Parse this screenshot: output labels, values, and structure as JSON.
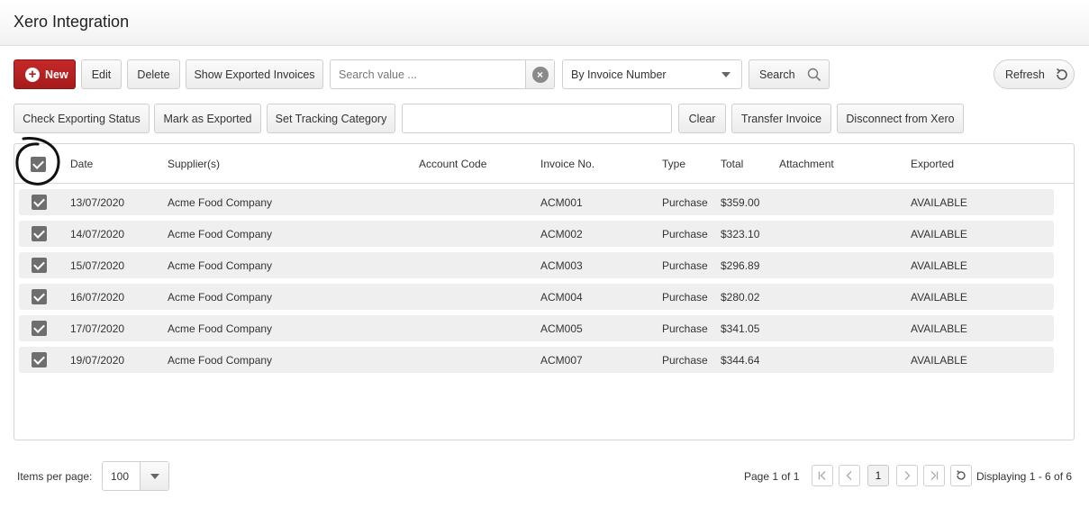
{
  "header": {
    "title": "Xero Integration"
  },
  "toolbar1": {
    "new_label": "New",
    "edit_label": "Edit",
    "delete_label": "Delete",
    "show_exported_label": "Show Exported Invoices",
    "search_placeholder": "Search value ...",
    "search_by_selected": "By Invoice Number",
    "search_label": "Search",
    "refresh_label": "Refresh"
  },
  "toolbar2": {
    "check_status_label": "Check Exporting Status",
    "mark_exported_label": "Mark as Exported",
    "set_tracking_label": "Set Tracking Category",
    "tracking_value": "",
    "clear_label": "Clear",
    "transfer_label": "Transfer Invoice",
    "disconnect_label": "Disconnect from Xero"
  },
  "table": {
    "columns": [
      "Date",
      "Supplier(s)",
      "Account Code",
      "Invoice No.",
      "Type",
      "Total",
      "Attachment",
      "Exported"
    ],
    "rows": [
      {
        "date": "13/07/2020",
        "supplier": "Acme Food Company",
        "account_code": "",
        "invoice_no": "ACM001",
        "type": "Purchase",
        "total": "$359.00",
        "attachment": "",
        "exported": "AVAILABLE"
      },
      {
        "date": "14/07/2020",
        "supplier": "Acme Food Company",
        "account_code": "",
        "invoice_no": "ACM002",
        "type": "Purchase",
        "total": "$323.10",
        "attachment": "",
        "exported": "AVAILABLE"
      },
      {
        "date": "15/07/2020",
        "supplier": "Acme Food Company",
        "account_code": "",
        "invoice_no": "ACM003",
        "type": "Purchase",
        "total": "$296.89",
        "attachment": "",
        "exported": "AVAILABLE"
      },
      {
        "date": "16/07/2020",
        "supplier": "Acme Food Company",
        "account_code": "",
        "invoice_no": "ACM004",
        "type": "Purchase",
        "total": "$280.02",
        "attachment": "",
        "exported": "AVAILABLE"
      },
      {
        "date": "17/07/2020",
        "supplier": "Acme Food Company",
        "account_code": "",
        "invoice_no": "ACM005",
        "type": "Purchase",
        "total": "$341.05",
        "attachment": "",
        "exported": "AVAILABLE"
      },
      {
        "date": "19/07/2020",
        "supplier": "Acme Food Company",
        "account_code": "",
        "invoice_no": "ACM007",
        "type": "Purchase",
        "total": "$344.64",
        "attachment": "",
        "exported": "AVAILABLE"
      }
    ]
  },
  "footer": {
    "items_per_page_label": "Items per page:",
    "items_per_page_value": "100",
    "page_info": "Page 1 of 1",
    "current_page": "1",
    "displaying": "Displaying 1 - 6 of 6"
  },
  "colors": {
    "accent": "#b71c1c",
    "row_bg": "#efefef",
    "checkbox": "#6e6e6e"
  },
  "icons": [
    "plus-circle-icon",
    "clear-icon",
    "chevron-down-icon",
    "search-icon",
    "refresh-icon",
    "checkbox-icon",
    "first-page-icon",
    "prev-page-icon",
    "next-page-icon",
    "last-page-icon"
  ]
}
